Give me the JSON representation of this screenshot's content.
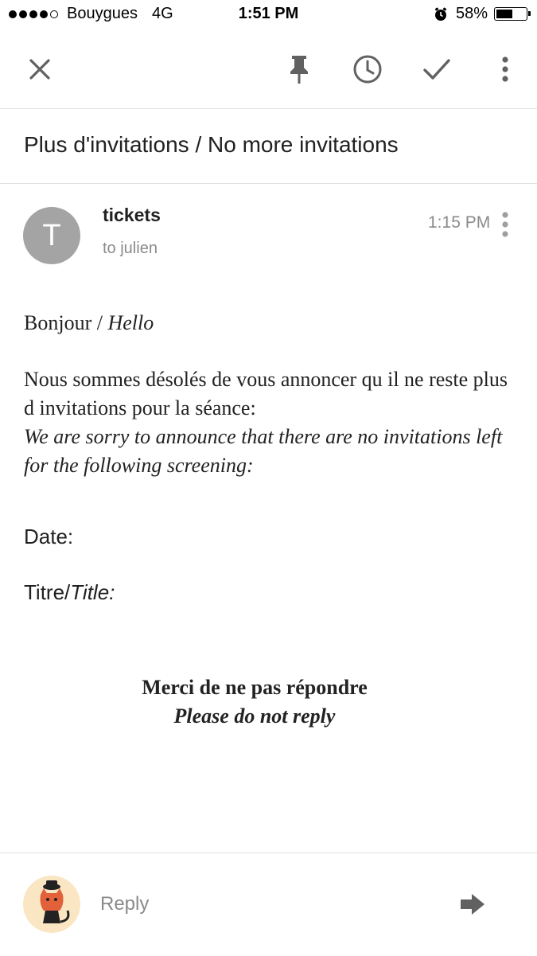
{
  "status_bar": {
    "signal_bars_filled": 4,
    "signal_bars_total": 5,
    "carrier": "Bouygues",
    "network": "4G",
    "time": "1:51 PM",
    "alarm_icon": "alarm-clock-icon",
    "battery_percent": "58%",
    "battery_level": 0.58
  },
  "toolbar": {
    "icons": [
      "close-icon",
      "pin-icon",
      "snooze-clock-icon",
      "done-check-icon",
      "more-vert-icon"
    ]
  },
  "email": {
    "subject": "Plus d'invitations / No more invitations",
    "sender": {
      "initial": "T",
      "name": "tickets",
      "recipient": "to julien",
      "time": "1:15 PM",
      "avatar_color": "#a4a4a4"
    },
    "body": {
      "greeting_fr": "Bonjour /",
      "greeting_en": "Hello",
      "para_fr": "Nous sommes désolés de vous annoncer qu il ne reste plus d invitations pour la séance:",
      "para_en": "We are sorry to announce that there are no invitations left for the following screening:",
      "date_label": "Date:",
      "title_label_fr": "Titre/",
      "title_label_en": "Title:",
      "noreply_fr": "Merci de ne pas répondre",
      "noreply_en": "Please do not reply"
    }
  },
  "reply_bar": {
    "placeholder": "Reply",
    "send_icon": "send-arrow-icon"
  }
}
